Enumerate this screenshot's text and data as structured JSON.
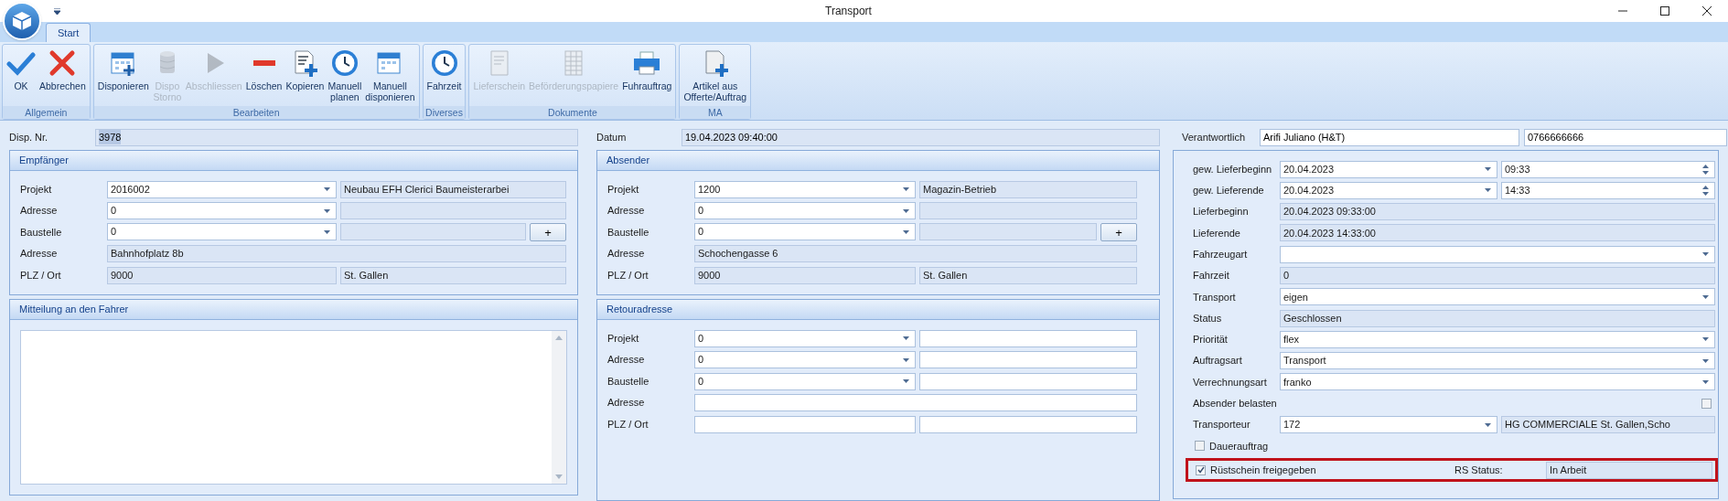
{
  "window": {
    "title": "Transport"
  },
  "tabs": [
    {
      "label": "Start",
      "selected": true
    }
  ],
  "ribbon": [
    {
      "label": "Allgemein",
      "buttons": [
        {
          "label": "OK",
          "kind": "check",
          "disabled": false
        },
        {
          "label": "Abbrechen",
          "kind": "cross",
          "disabled": false
        }
      ]
    },
    {
      "label": "Bearbeiten",
      "buttons": [
        {
          "label": "Disponieren",
          "kind": "calendar_plus",
          "disabled": false
        },
        {
          "label": "Dispo\nStorno",
          "kind": "database",
          "disabled": true
        },
        {
          "label": "Abschliessen",
          "kind": "play",
          "disabled": true
        },
        {
          "label": "Löschen",
          "kind": "minus",
          "disabled": false
        },
        {
          "label": "Kopieren",
          "kind": "doc_plus",
          "disabled": false
        },
        {
          "label": "Manuell\nplanen",
          "kind": "clock",
          "disabled": false
        },
        {
          "label": "Manuell\ndisponieren",
          "kind": "calendar",
          "disabled": false
        }
      ]
    },
    {
      "label": "Diverses",
      "buttons": [
        {
          "label": "Fahrzeit",
          "kind": "clock",
          "disabled": false
        }
      ]
    },
    {
      "label": "Dokumente",
      "buttons": [
        {
          "label": "Lieferschein",
          "kind": "doc",
          "disabled": true
        },
        {
          "label": "Beförderungspapiere",
          "kind": "sheet",
          "disabled": true
        },
        {
          "label": "Fuhrauftrag",
          "kind": "printer",
          "disabled": false
        }
      ]
    },
    {
      "label": "MA",
      "buttons": [
        {
          "label": "Artikel aus\nOfferte/Auftrag",
          "kind": "page_plus",
          "disabled": false
        }
      ]
    }
  ],
  "disp_nr": {
    "label": "Disp. Nr.",
    "value": "3978"
  },
  "datum": {
    "label": "Datum",
    "value": "19.04.2023 09:40:00"
  },
  "verantwortlich": {
    "label": "Verantwortlich",
    "value": "Arifi Juliano (H&T)",
    "phone": "0766666666"
  },
  "recipient": {
    "title": "Empfänger",
    "rows": [
      {
        "label": "Projekt",
        "fields": [
          {
            "kind": "combo",
            "value": "2016002"
          },
          {
            "kind": "readonly",
            "value": "Neubau EFH Clerici Baumeisterarbei"
          }
        ]
      },
      {
        "label": "Adresse",
        "fields": [
          {
            "kind": "combo",
            "value": "0"
          },
          {
            "kind": "readonly"
          }
        ]
      },
      {
        "label": "Baustelle",
        "fields": [
          {
            "kind": "combo",
            "value": "0"
          },
          {
            "kind": "readonly"
          }
        ],
        "button": "+"
      },
      {
        "label": "Adresse",
        "fields": [
          {
            "kind": "readonly",
            "value": "Bahnhofplatz 8b"
          }
        ]
      },
      {
        "label": "PLZ / Ort",
        "fields": [
          {
            "kind": "readonly",
            "value": "9000"
          },
          {
            "kind": "readonly",
            "value": "St. Gallen"
          }
        ]
      }
    ]
  },
  "message": {
    "title": "Mitteilung an den Fahrer"
  },
  "sender": {
    "title": "Absender",
    "rows": [
      {
        "label": "Projekt",
        "fields": [
          {
            "kind": "combo",
            "value": "1200"
          },
          {
            "kind": "readonly",
            "value": "Magazin-Betrieb"
          }
        ]
      },
      {
        "label": "Adresse",
        "fields": [
          {
            "kind": "combo",
            "value": "0"
          },
          {
            "kind": "readonly"
          }
        ]
      },
      {
        "label": "Baustelle",
        "fields": [
          {
            "kind": "combo",
            "value": "0"
          },
          {
            "kind": "readonly"
          }
        ],
        "button": "+"
      },
      {
        "label": "Adresse",
        "fields": [
          {
            "kind": "readonly",
            "value": "Schochengasse 6"
          }
        ]
      },
      {
        "label": "PLZ / Ort",
        "fields": [
          {
            "kind": "readonly",
            "value": "9000"
          },
          {
            "kind": "readonly",
            "value": "St. Gallen"
          }
        ]
      }
    ]
  },
  "return_address": {
    "title": "Retouradresse",
    "rows": [
      {
        "label": "Projekt",
        "fields": [
          {
            "kind": "combo",
            "value": "0"
          },
          {
            "kind": "text"
          }
        ]
      },
      {
        "label": "Adresse",
        "fields": [
          {
            "kind": "combo",
            "value": "0"
          },
          {
            "kind": "text"
          }
        ]
      },
      {
        "label": "Baustelle",
        "fields": [
          {
            "kind": "combo",
            "value": "0"
          },
          {
            "kind": "text"
          }
        ]
      },
      {
        "label": "Adresse",
        "fields": [
          {
            "kind": "text"
          }
        ]
      },
      {
        "label": "PLZ / Ort",
        "fields": [
          {
            "kind": "text"
          },
          {
            "kind": "text"
          }
        ]
      }
    ]
  },
  "delivery": {
    "rows": [
      {
        "kind": "fields",
        "label": "gew. Lieferbeginn",
        "fields": [
          {
            "kind": "combo",
            "value": "20.04.2023"
          },
          {
            "kind": "spin",
            "value": "09:33"
          }
        ]
      },
      {
        "kind": "fields",
        "label": "gew. Lieferende",
        "fields": [
          {
            "kind": "combo",
            "value": "20.04.2023"
          },
          {
            "kind": "spin",
            "value": "14:33"
          }
        ]
      },
      {
        "kind": "fields",
        "label": "Lieferbeginn",
        "fields": [
          {
            "kind": "readonly",
            "value": "20.04.2023 09:33:00"
          }
        ]
      },
      {
        "kind": "fields",
        "label": "Lieferende",
        "fields": [
          {
            "kind": "readonly",
            "value": "20.04.2023 14:33:00"
          }
        ]
      },
      {
        "kind": "fields",
        "label": "Fahrzeugart",
        "fields": [
          {
            "kind": "combo"
          }
        ]
      },
      {
        "kind": "fields",
        "label": "Fahrzeit",
        "fields": [
          {
            "kind": "readonly",
            "value": "0"
          }
        ]
      },
      {
        "kind": "fields",
        "label": "Transport",
        "fields": [
          {
            "kind": "combo",
            "value": "eigen"
          }
        ]
      },
      {
        "kind": "fields",
        "label": "Status",
        "fields": [
          {
            "kind": "readonly",
            "value": "Geschlossen"
          }
        ]
      },
      {
        "kind": "fields",
        "label": "Priorität",
        "fields": [
          {
            "kind": "combo",
            "value": "flex"
          }
        ]
      },
      {
        "kind": "fields",
        "label": "Auftragsart",
        "fields": [
          {
            "kind": "combo",
            "value": "Transport"
          }
        ]
      },
      {
        "kind": "fields",
        "label": "Verrechnungsart",
        "fields": [
          {
            "kind": "combo",
            "value": "franko"
          }
        ]
      },
      {
        "kind": "checkbox_right",
        "label": "Absender belasten",
        "checked": false
      },
      {
        "kind": "fields",
        "label": "Transporteur",
        "fields": [
          {
            "kind": "combo",
            "value": "172"
          },
          {
            "kind": "readonly",
            "value": "HG COMMERCIALE St. Gallen,Scho"
          }
        ]
      },
      {
        "kind": "checkbox",
        "label": "Dauerauftrag",
        "checked": false
      },
      {
        "kind": "checkbox_status",
        "label": "Rüstschein freigegeben",
        "checked": true,
        "highlighted": true,
        "status_label": "RS Status:",
        "status_value": "In Arbeit"
      }
    ]
  }
}
